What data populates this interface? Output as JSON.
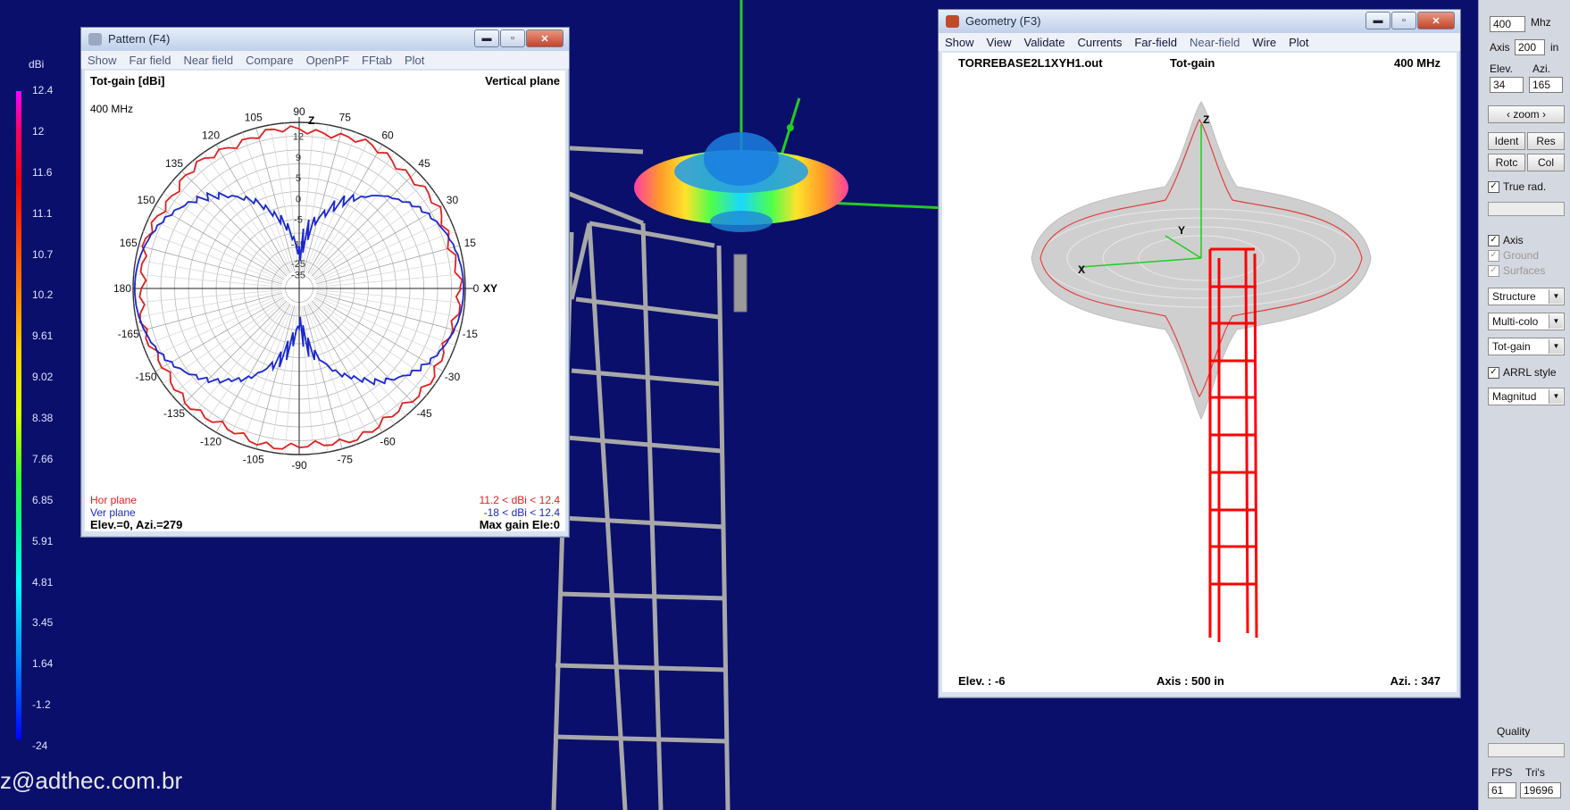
{
  "colors": {
    "desktop_bg": "#0a0f6b",
    "hor_plane": "#e02020",
    "ver_plane": "#1a28d0",
    "structure": "#ff0000"
  },
  "scale": {
    "unit": "dBi",
    "ticks": [
      "12.4",
      "12",
      "11.6",
      "11.1",
      "10.7",
      "10.2",
      "9.61",
      "9.02",
      "8.38",
      "7.66",
      "6.85",
      "5.91",
      "4.81",
      "3.45",
      "1.64",
      "-1.2",
      "-24"
    ]
  },
  "footer_email": "z@adthec.com.br",
  "pattern_window": {
    "title": "Pattern  (F4)",
    "menu": [
      "Show",
      "Far field",
      "Near field",
      "Compare",
      "OpenPF",
      "FFtab",
      "Plot"
    ],
    "top_left": "Tot-gain [dBi]",
    "top_right": "Vertical plane",
    "freq": "400 MHz",
    "legend_hor": "Hor plane",
    "legend_ver": "Ver plane",
    "range_hor": "11.2 < dBi < 12.4",
    "range_ver": "-18 < dBi < 12.4",
    "bottom_left": "Elev.=0, Azi.=279",
    "bottom_right": "Max gain Ele:0",
    "angle_labels": [
      "90",
      "75",
      "60",
      "45",
      "30",
      "15",
      "0",
      "-15",
      "-30",
      "-45",
      "-60",
      "-75",
      "-90",
      "-105",
      "-120",
      "-135",
      "-150",
      "-165",
      "180",
      "165",
      "150",
      "135",
      "120",
      "105"
    ],
    "ring_labels": [
      "12",
      "9",
      "5",
      "0",
      "-5",
      "-15",
      "-25",
      "-35"
    ],
    "axis_z": "Z",
    "axis_xy": "XY"
  },
  "geometry_window": {
    "title": "Geometry  (F3)",
    "menu": [
      "Show",
      "View",
      "Validate",
      "Currents",
      "Far-field",
      "Near-field",
      "Wire",
      "Plot"
    ],
    "file": "TORREBASE2L1XYH1.out",
    "mode": "Tot-gain",
    "freq": "400 MHz",
    "bottom_left": "Elev. : -6",
    "bottom_mid": "Axis : 500 in",
    "bottom_right": "Azi. : 347",
    "axis_z": "Z",
    "axis_y": "Y",
    "axis_x": "X"
  },
  "side_panel": {
    "freq_value": "400",
    "freq_unit": "Mhz",
    "axis_label": "Axis",
    "axis_value": "200",
    "axis_unit": "in",
    "elev_label": "Elev.",
    "azi_label": "Azi.",
    "elev_value": "34",
    "azi_value": "165",
    "zoom_label": "zoom",
    "ident": "Ident",
    "res": "Res",
    "rotc": "Rotc",
    "col": "Col",
    "true_rad": "True rad.",
    "axis_cb": "Axis",
    "ground_cb": "Ground",
    "surfaces_cb": "Surfaces",
    "select1": "Structure",
    "select2": "Multi-colo",
    "select3": "Tot-gain",
    "arrl": "ARRL style",
    "select4": "Magnitud",
    "quality": "Quality",
    "fps_label": "FPS",
    "tris_label": "Tri's",
    "fps_value": "61",
    "tris_value": "19696"
  }
}
